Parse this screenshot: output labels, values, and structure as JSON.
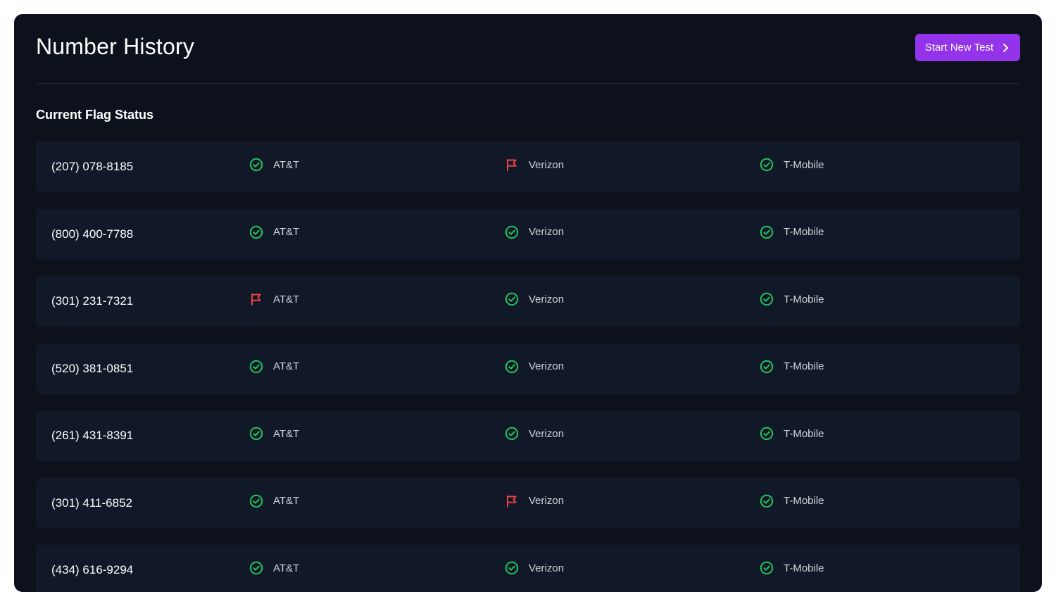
{
  "header": {
    "title": "Number History",
    "cta_label": "Start New Test"
  },
  "section": {
    "title": "Current Flag Status"
  },
  "colors": {
    "ok": "#22c55e",
    "flagged": "#ef4444",
    "accent": "#9333ea"
  },
  "rows": [
    {
      "phone": "(207) 078-8185",
      "carriers": [
        {
          "name": "AT&T",
          "status": "ok",
          "icon": "check-circle-icon"
        },
        {
          "name": "Verizon",
          "status": "flagged",
          "icon": "flag-icon"
        },
        {
          "name": "T-Mobile",
          "status": "ok",
          "icon": "check-circle-icon"
        }
      ]
    },
    {
      "phone": "(800) 400-7788",
      "carriers": [
        {
          "name": "AT&T",
          "status": "ok",
          "icon": "check-circle-icon"
        },
        {
          "name": "Verizon",
          "status": "ok",
          "icon": "check-circle-icon"
        },
        {
          "name": "T-Mobile",
          "status": "ok",
          "icon": "check-circle-icon"
        }
      ]
    },
    {
      "phone": "(301) 231-7321",
      "carriers": [
        {
          "name": "AT&T",
          "status": "flagged",
          "icon": "flag-icon"
        },
        {
          "name": "Verizon",
          "status": "ok",
          "icon": "check-circle-icon"
        },
        {
          "name": "T-Mobile",
          "status": "ok",
          "icon": "check-circle-icon"
        }
      ]
    },
    {
      "phone": "(520) 381-0851",
      "carriers": [
        {
          "name": "AT&T",
          "status": "ok",
          "icon": "check-circle-icon"
        },
        {
          "name": "Verizon",
          "status": "ok",
          "icon": "check-circle-icon"
        },
        {
          "name": "T-Mobile",
          "status": "ok",
          "icon": "check-circle-icon"
        }
      ]
    },
    {
      "phone": "(261) 431-8391",
      "carriers": [
        {
          "name": "AT&T",
          "status": "ok",
          "icon": "check-circle-icon"
        },
        {
          "name": "Verizon",
          "status": "ok",
          "icon": "check-circle-icon"
        },
        {
          "name": "T-Mobile",
          "status": "ok",
          "icon": "check-circle-icon"
        }
      ]
    },
    {
      "phone": "(301) 411-6852",
      "carriers": [
        {
          "name": "AT&T",
          "status": "ok",
          "icon": "check-circle-icon"
        },
        {
          "name": "Verizon",
          "status": "flagged",
          "icon": "flag-icon"
        },
        {
          "name": "T-Mobile",
          "status": "ok",
          "icon": "check-circle-icon"
        }
      ]
    },
    {
      "phone": "(434) 616-9294",
      "carriers": [
        {
          "name": "AT&T",
          "status": "ok",
          "icon": "check-circle-icon"
        },
        {
          "name": "Verizon",
          "status": "ok",
          "icon": "check-circle-icon"
        },
        {
          "name": "T-Mobile",
          "status": "ok",
          "icon": "check-circle-icon"
        }
      ]
    }
  ]
}
